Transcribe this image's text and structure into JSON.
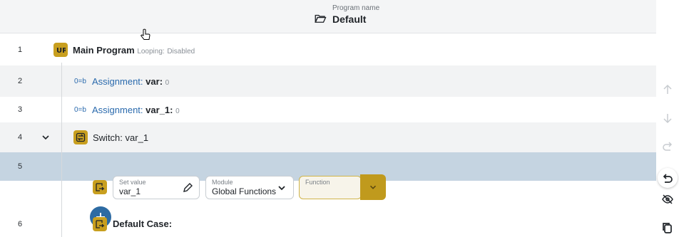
{
  "header": {
    "program_name_label": "Program name",
    "program_name_value": "Default"
  },
  "rows": [
    {
      "num": "1",
      "icon": "ur-logo-icon",
      "title": "Main Program",
      "extra_label": "Looping:",
      "extra_value": "Disabled"
    },
    {
      "num": "2",
      "icon": "assignment-icon",
      "icon_text": "0=b",
      "keyword": "Assignment:",
      "var": "var:",
      "value": "0"
    },
    {
      "num": "3",
      "icon": "assignment-icon",
      "icon_text": "0=b",
      "keyword": "Assignment:",
      "var": "var_1:",
      "value": "0"
    },
    {
      "num": "4",
      "icon": "switch-icon",
      "title": "Switch:",
      "var": "var_1"
    },
    {
      "num": "5",
      "icon": "case-icon"
    },
    {
      "num": "6",
      "icon": "case-icon",
      "title": "Default Case:"
    }
  ],
  "case_editor": {
    "set_value": {
      "label": "Set value",
      "value": "var_1"
    },
    "module": {
      "label": "Module",
      "value": "Global Functions"
    },
    "function": {
      "label": "Function",
      "value": ""
    }
  },
  "colors": {
    "accent_gold": "#c89f1f",
    "accent_blue": "#2d6ba3",
    "selected_row": "#c5d4e1"
  },
  "side_toolbar": [
    "move-up-icon",
    "move-down-icon",
    "redo-icon",
    "undo-icon",
    "hide-icon",
    "copy-icon"
  ]
}
